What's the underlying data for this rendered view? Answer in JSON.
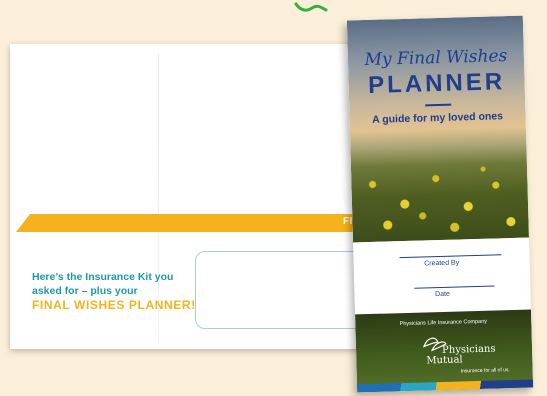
{
  "mailer": {
    "band_text": "FIR",
    "pitch_line1": "Here’s the Insurance Kit you",
    "pitch_line2": "asked for – plus your",
    "pitch_strong": "FINAL WISHES PLANNER!"
  },
  "planner": {
    "script_title": "My Final Wishes",
    "title": "PLANNER",
    "subtitle": "A guide for my loved ones",
    "created_by_label": "Created By",
    "date_label": "Date",
    "company": "Physicians Life Insurance Company",
    "brand_line1": "Physicians",
    "brand_line2": "Mutual",
    "tagline": "Insurance for all of us."
  },
  "colors": {
    "background": "#fbefd9",
    "accent_yellow": "#f6b21c",
    "teal_text": "#1f9aa5",
    "navy": "#1f3e8c"
  }
}
